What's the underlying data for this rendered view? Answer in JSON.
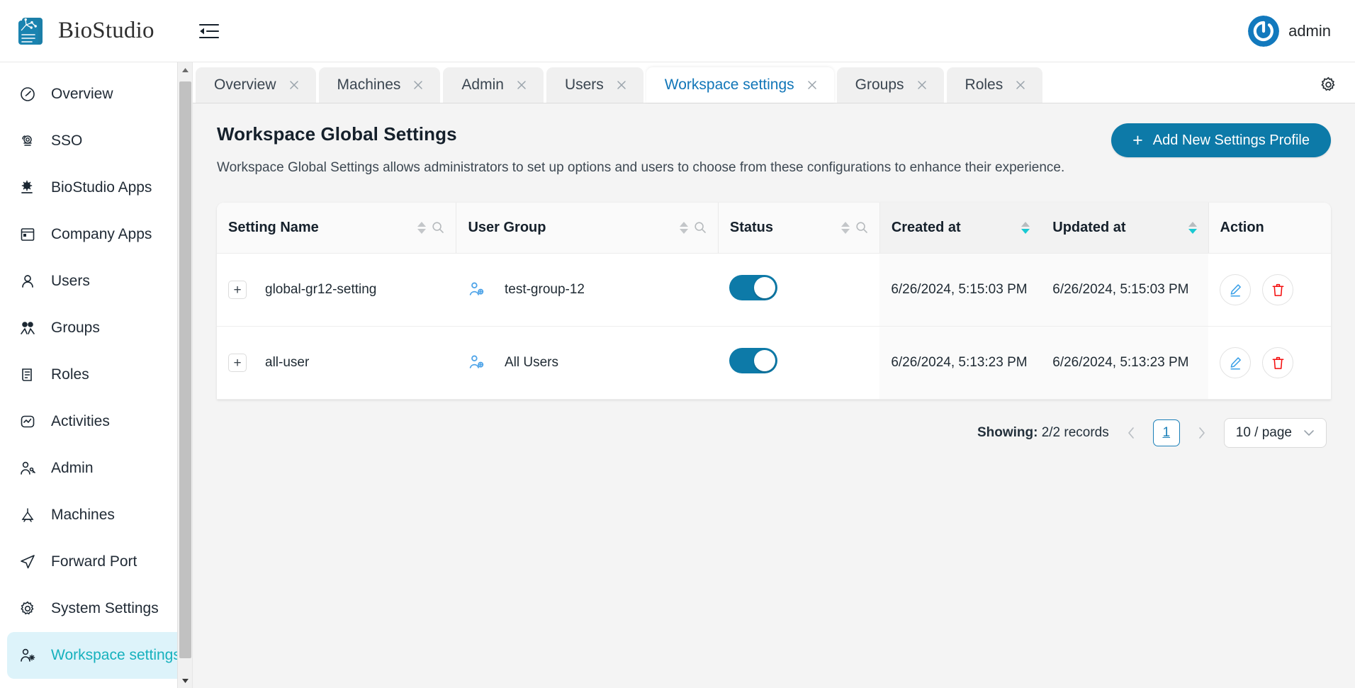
{
  "topbar": {
    "brand_name": "BioStudio",
    "collapse_icon": "collapse-sidebar-icon",
    "logo_icon": "biostudio-logo-icon",
    "user_name": "admin",
    "avatar_icon": "user-avatar-power-icon"
  },
  "sidebar": {
    "items": [
      {
        "label": "Overview",
        "icon": "gauge-icon",
        "active": false
      },
      {
        "label": "SSO",
        "icon": "sso-cloud-icon",
        "active": false
      },
      {
        "label": "BioStudio Apps",
        "icon": "app-gear-icon",
        "active": false
      },
      {
        "label": "Company Apps",
        "icon": "window-icon",
        "active": false
      },
      {
        "label": "Users",
        "icon": "user-icon",
        "active": false
      },
      {
        "label": "Groups",
        "icon": "group-icon",
        "active": false
      },
      {
        "label": "Roles",
        "icon": "scroll-icon",
        "active": false
      },
      {
        "label": "Activities",
        "icon": "activity-icon",
        "active": false
      },
      {
        "label": "Admin",
        "icon": "user-key-icon",
        "active": false
      },
      {
        "label": "Machines",
        "icon": "machine-icon",
        "active": false
      },
      {
        "label": "Forward Port",
        "icon": "send-icon",
        "active": false
      },
      {
        "label": "System Settings",
        "icon": "gear-icon",
        "active": false
      },
      {
        "label": "Workspace settings",
        "icon": "user-gear-icon",
        "active": true
      }
    ],
    "scroll_up_icon": "scroll-up-arrow-icon",
    "scroll_down_icon": "scroll-down-arrow-icon"
  },
  "tabs": {
    "items": [
      {
        "label": "Overview",
        "active": false
      },
      {
        "label": "Machines",
        "active": false
      },
      {
        "label": "Admin",
        "active": false
      },
      {
        "label": "Users",
        "active": false
      },
      {
        "label": "Workspace settings",
        "active": true
      },
      {
        "label": "Groups",
        "active": false
      },
      {
        "label": "Roles",
        "active": false
      }
    ],
    "close_icon": "close-icon",
    "settings_icon": "gear-icon"
  },
  "page": {
    "title": "Workspace Global Settings",
    "description": "Workspace Global Settings allows administrators to set up options and users to choose from these configurations to enhance their experience.",
    "add_button": {
      "label": "Add New Settings Profile",
      "plus": "+",
      "icon": "plus-icon"
    }
  },
  "table": {
    "columns": [
      {
        "label": "Setting Name",
        "sortable": true,
        "searchable": true,
        "sort": "none",
        "sorted": false
      },
      {
        "label": "User Group",
        "sortable": true,
        "searchable": true,
        "sort": "none",
        "sorted": false
      },
      {
        "label": "Status",
        "sortable": true,
        "searchable": true,
        "sort": "none",
        "sorted": false
      },
      {
        "label": "Created at",
        "sortable": true,
        "searchable": false,
        "sort": "desc",
        "sorted": true
      },
      {
        "label": "Updated at",
        "sortable": true,
        "searchable": false,
        "sort": "desc",
        "sorted": true
      },
      {
        "label": "Action",
        "sortable": false,
        "searchable": false,
        "sort": "none",
        "sorted": false
      }
    ],
    "rows": [
      {
        "expander": "+",
        "setting_name": "global-gr12-setting",
        "user_group": "test-group-12",
        "group_icon": "group-add-icon",
        "status_on": true,
        "created_at": "6/26/2024, 5:15:03 PM",
        "updated_at": "6/26/2024, 5:15:03 PM",
        "edit_icon": "edit-pencil-icon",
        "delete_icon": "trash-icon"
      },
      {
        "expander": "+",
        "setting_name": "all-user",
        "user_group": "All Users",
        "group_icon": "group-add-icon",
        "status_on": true,
        "created_at": "6/26/2024, 5:13:23 PM",
        "updated_at": "6/26/2024, 5:13:23 PM",
        "edit_icon": "edit-pencil-icon",
        "delete_icon": "trash-icon"
      }
    ],
    "sort_icon": "sort-arrows-icon",
    "search_icon": "search-icon"
  },
  "pagination": {
    "showing_label": "Showing:",
    "records_text": "2/2 records",
    "prev_icon": "chevron-left-icon",
    "next_icon": "chevron-right-icon",
    "current_page": "1",
    "page_size": "10 / page",
    "chevron_icon": "chevron-down-icon"
  },
  "colors": {
    "brand_blue": "#0d7aa8",
    "accent_teal": "#16b1bd",
    "active_nav_bg": "#ddf3fa",
    "tab_active_text": "#1176b8",
    "delete_red": "#f40d0d",
    "edit_blue": "#3aa0e8",
    "sort_active": "#19c9d2"
  }
}
